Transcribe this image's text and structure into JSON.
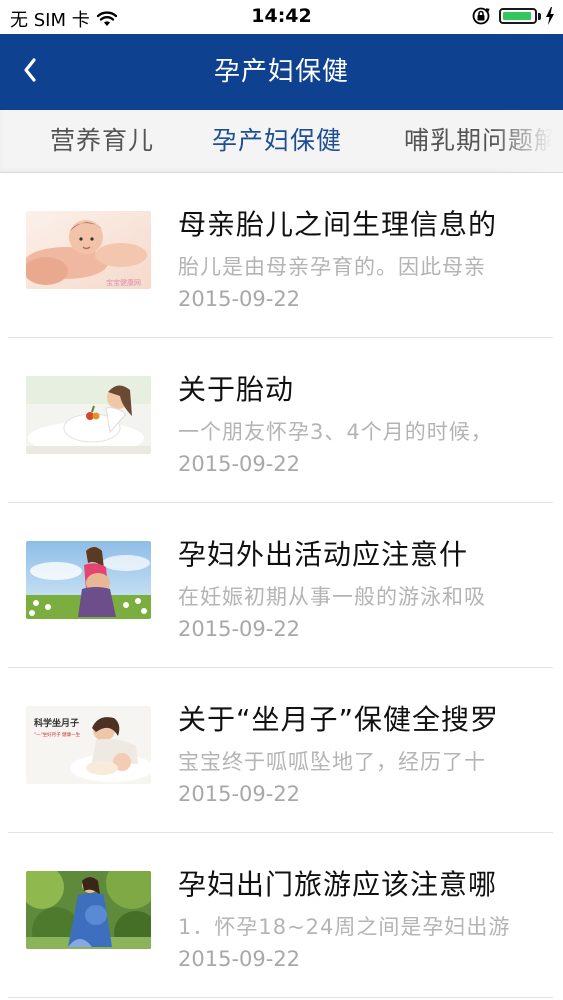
{
  "status_bar": {
    "carrier": "无 SIM 卡",
    "time": "14:42",
    "battery_level": 0.95,
    "icons": [
      "wifi-icon",
      "rotation-lock-icon",
      "battery-icon",
      "charging-icon"
    ]
  },
  "nav": {
    "title": "孕产妇保健",
    "back_icon": "chevron-left-icon",
    "bg_color": "#0e4290"
  },
  "tabs": [
    {
      "label": "营养育儿",
      "active": false
    },
    {
      "label": "孕产妇保健",
      "active": true
    },
    {
      "label": "哺乳期问题解",
      "active": false
    }
  ],
  "articles": [
    {
      "title": "母亲胎儿之间生理信息的",
      "summary": "胎儿是由母亲孕育的。因此母亲",
      "date": "2015-09-22",
      "thumb": "baby-lying-photo"
    },
    {
      "title": "关于胎动",
      "summary": "一个朋友怀孕3、4个月的时候，",
      "date": "2015-09-22",
      "thumb": "pregnant-woman-reclining-photo"
    },
    {
      "title": "孕妇外出活动应注意什",
      "summary": "在妊娠初期从事一般的游泳和吸",
      "date": "2015-09-22",
      "thumb": "pregnant-woman-field-photo"
    },
    {
      "title": "关于“坐月子”保健全搜罗",
      "summary": "宝宝终于呱呱坠地了，经历了十",
      "date": "2015-09-22",
      "thumb": "mother-newborn-photo"
    },
    {
      "title": "孕妇出门旅游应该注意哪",
      "summary": "1．怀孕18~24周之间是孕妇出游",
      "date": "2015-09-22",
      "thumb": "pregnant-woman-forest-photo"
    }
  ],
  "thumb_texts": {
    "baby": "宝宝健康网",
    "postpartum_title": "科学坐月子",
    "postpartum_sub": "\"一\"坐好月子 健康一生"
  }
}
